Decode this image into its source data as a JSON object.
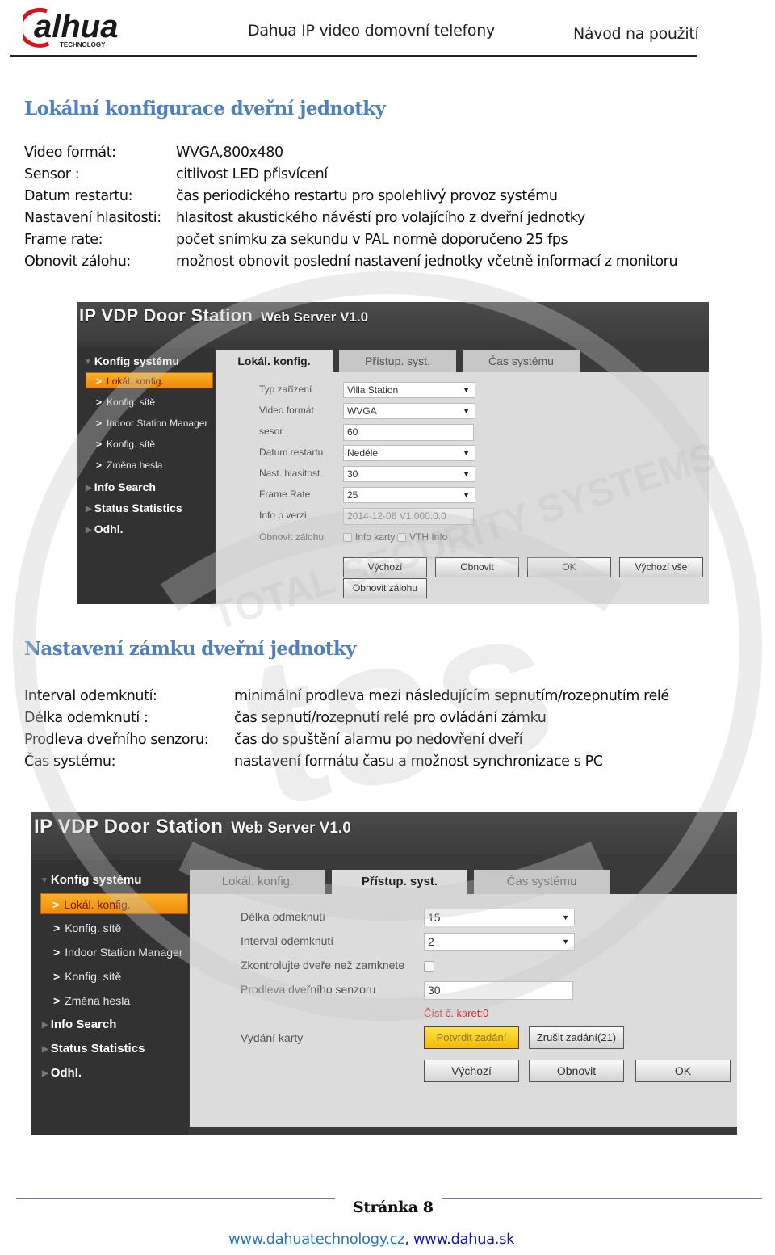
{
  "header": {
    "logo_text": "alhua",
    "logo_sub": "TECHNOLOGY",
    "title": "Dahua IP video domovní telefony",
    "doc_type": "Návod na použití"
  },
  "section1": {
    "title": "Lokální konfigurace dveřní jednotky",
    "items": [
      {
        "term": "Video formát:",
        "desc": "WVGA,800x480"
      },
      {
        "term": "Sensor :",
        "desc": "citlivost LED přisvícení"
      },
      {
        "term": "Datum restartu:",
        "desc": "čas periodického restartu pro spolehlivý provoz systému"
      },
      {
        "term": "Nastavení hlasitosti:",
        "desc": "hlasitost akustického návěstí pro volajícího z dveřní jednotky"
      },
      {
        "term": "Frame rate:",
        "desc": "počet snímku za sekundu v PAL normě doporučeno 25 fps"
      },
      {
        "term": "Obnovit zálohu:",
        "desc": "možnost obnovit poslední nastavení jednotky včetně informací z monitoru"
      }
    ]
  },
  "webui1": {
    "brand": "IP VDP Door Station",
    "brand_sub": "Web Server V1.0",
    "sidebar": {
      "group1": "Konfig systému",
      "items": [
        "Lokál. konfig.",
        "Konfig. sítě",
        "Indoor Station Manager",
        "Konfig. sítě",
        "Změna hesla"
      ],
      "group2": "Info Search",
      "group3": "Status Statistics",
      "group4": "Odhl."
    },
    "tabs": [
      "Lokál. konfig.",
      "Přístup. syst.",
      "Čas systému"
    ],
    "active_tab": "Lokál. konfig.",
    "fields": [
      {
        "label": "Typ zařízení",
        "value": "Villa Station",
        "type": "select"
      },
      {
        "label": "Video formát",
        "value": "WVGA",
        "type": "select"
      },
      {
        "label": "sesor",
        "value": "60",
        "type": "text"
      },
      {
        "label": "Datum restartu",
        "value": "Neděle",
        "type": "select"
      },
      {
        "label": "Nast. hlasitost.",
        "value": "30",
        "type": "select"
      },
      {
        "label": "Frame Rate",
        "value": "25",
        "type": "select"
      },
      {
        "label": "Info o verzi",
        "value": "2014-12-06 V1.000.0.0",
        "type": "readonly"
      }
    ],
    "restore_label": "Obnovit zálohu",
    "restore_options": [
      "Info karty",
      "VTH Info"
    ],
    "buttons": [
      "Výchozí",
      "Obnovit",
      "OK",
      "Výchozí vše"
    ],
    "restore_button": "Obnovit zálohu"
  },
  "section2": {
    "title": "Nastavení zámku dveřní jednotky",
    "items": [
      {
        "term": "Interval odemknutí:",
        "desc": "minimální prodleva mezi následujícím sepnutím/rozepnutím relé"
      },
      {
        "term": "Délka odemknutí :",
        "desc": "čas sepnutí/rozepnutí relé pro ovládání zámku"
      },
      {
        "term": "Prodleva dveřního senzoru:",
        "desc": "čas do spuštění alarmu po nedovření dveří"
      },
      {
        "term": "Čas systému:",
        "desc": "nastavení formátu času a možnost synchronizace s PC"
      }
    ]
  },
  "webui2": {
    "brand": "IP VDP Door Station",
    "brand_sub": "Web Server V1.0",
    "sidebar": {
      "group1": "Konfig systému",
      "items": [
        "Lokál. konfig.",
        "Konfig. sítě",
        "Indoor Station Manager",
        "Konfig. sítě",
        "Změna hesla"
      ],
      "group2": "Info Search",
      "group3": "Status Statistics",
      "group4": "Odhl."
    },
    "tabs": [
      "Lokál. konfig.",
      "Přístup. syst.",
      "Čas systému"
    ],
    "active_tab": "Přístup. syst.",
    "fields": [
      {
        "label": "Délka odmeknutí",
        "value": "15",
        "type": "select"
      },
      {
        "label": "Interval odemknutí",
        "value": "2",
        "type": "select"
      },
      {
        "label": "Zkontrolujte dveře než zamknete",
        "value": "",
        "type": "checkbox"
      },
      {
        "label": "Prodleva dveřního senzoru",
        "value": "30",
        "type": "text"
      }
    ],
    "card_count": "Číst č. karet:0",
    "card_label": "Vydání karty",
    "card_confirm": "Potvrdit zadání",
    "card_cancel": "Zrušit zadání(21)",
    "buttons": [
      "Výchozí",
      "Obnovit",
      "OK"
    ]
  },
  "footer": {
    "page": "Stránka 8",
    "link1": "www.dahuatechnology.cz",
    "separator": ",",
    "link2": "www.dahua.sk"
  }
}
